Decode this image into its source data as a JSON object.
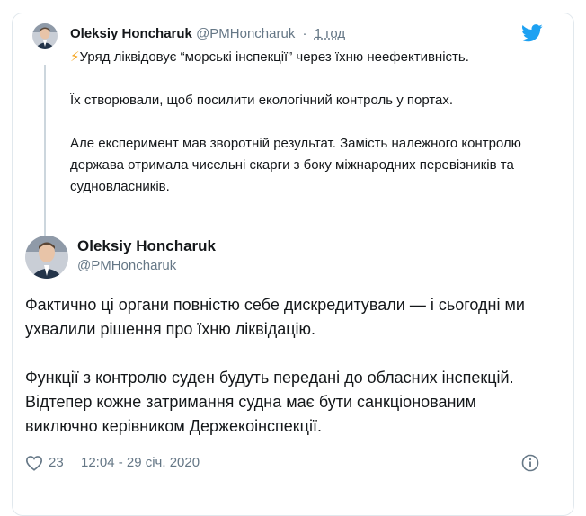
{
  "brand": {
    "icon": "twitter-bird-icon",
    "color": "#1da1f2"
  },
  "quoted": {
    "name": "Oleksiy Honcharuk",
    "handle": "@PMHoncharuk",
    "separator": "·",
    "time": "1 год",
    "emoji": "⚡",
    "line1": "Уряд ліквідовує “морські інспекції” через їхню неефективність.",
    "p2": "Їх створювали, щоб посилити екологічний контроль у портах.",
    "p3": "Але експеримент мав зворотній результат. Замість належного контролю держава отримала чисельні скарги з боку міжнародних перевізників та судновласників."
  },
  "main": {
    "name": "Oleksiy Honcharuk",
    "handle": "@PMHoncharuk",
    "p1": "Фактично ці органи повністю себе дискредитували — і сьогодні ми ухвалили рішення про їхню ліквідацію.",
    "p2": "Функції з контролю суден будуть передані до обласних інспекцій. Відтепер кожне затримання судна має бути санкціонованим виключно керівником Держекоінспекції."
  },
  "footer": {
    "likes": "23",
    "timestamp": "12:04 - 29 січ. 2020",
    "like_icon": "heart-icon",
    "info_icon": "info-icon"
  }
}
